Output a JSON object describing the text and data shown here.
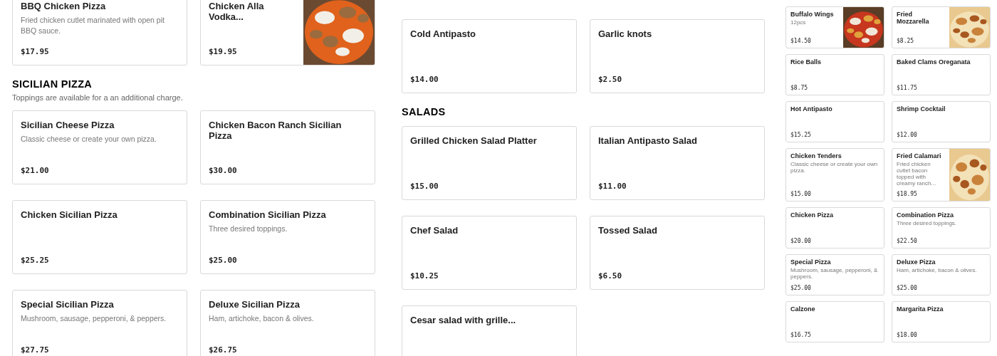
{
  "panels": [
    {
      "sections": [
        {
          "items": [
            {
              "name": "BBQ Chicken Pizza",
              "description": "Fried chicken cutlet marinated with open pit BBQ sauce.",
              "price": "$17.95"
            },
            {
              "name": "Chicken Alla Vodka...",
              "price": "$19.95"
            }
          ]
        },
        {
          "title": "SICILIAN PIZZA",
          "subtitle": "Toppings are available for a an additional charge.",
          "items": [
            {
              "name": "Sicilian Cheese Pizza",
              "description": "Classic cheese or create your own pizza.",
              "price": "$21.00"
            },
            {
              "name": "Chicken Bacon Ranch Sicilian Pizza",
              "price": "$30.00"
            },
            {
              "name": "Chicken Sicilian Pizza",
              "price": "$25.25"
            },
            {
              "name": "Combination Sicilian Pizza",
              "description": "Three desired toppings.",
              "price": "$25.00"
            },
            {
              "name": "Special Sicilian Pizza",
              "description": "Mushroom, sausage, pepperoni, & peppers.",
              "price": "$27.75"
            },
            {
              "name": "Deluxe Sicilian Pizza",
              "description": "Ham, artichoke, bacon & olives.",
              "price": "$26.75"
            }
          ]
        }
      ]
    },
    {
      "sections": [
        {
          "items": [
            {
              "name": "Cold Antipasto",
              "price": "$14.00"
            },
            {
              "name": "Garlic knots",
              "price": "$2.50"
            }
          ]
        },
        {
          "title": "SALADS",
          "items": [
            {
              "name": "Grilled Chicken Salad Platter",
              "price": "$15.00"
            },
            {
              "name": "Italian Antipasto Salad",
              "price": "$11.00"
            },
            {
              "name": "Chef Salad",
              "price": "$10.25"
            },
            {
              "name": "Tossed Salad",
              "price": "$6.50"
            },
            {
              "name": "Cesar salad with grille..."
            }
          ]
        }
      ]
    },
    {
      "sections": [
        {
          "items": [
            {
              "name": "Buffalo Wings",
              "description": "12pcs",
              "price": "$14.50"
            },
            {
              "name": "Fried Mozzarella",
              "price": "$8.25"
            },
            {
              "name": "Rice Balls",
              "price": "$8.75"
            },
            {
              "name": "Baked Clams Oreganata",
              "price": "$11.75"
            },
            {
              "name": "Hot Antipasto",
              "price": "$15.25"
            },
            {
              "name": "Shrimp Cocktail",
              "price": "$12.00"
            },
            {
              "name": "Chicken Tenders",
              "description": "Classic cheese or create your own pizza.",
              "price": "$15.00"
            },
            {
              "name": "Fried Calamari",
              "description": "Fried chicken cutlet bacon topped with creamy ranch...",
              "price": "$18.95"
            },
            {
              "name": "Chicken Pizza",
              "price": "$20.00"
            },
            {
              "name": "Combination Pizza",
              "description": "Three desired toppings.",
              "price": "$22.50"
            },
            {
              "name": "Special Pizza",
              "description": "Mushroom, sausage, pepperoni, & peppers.",
              "price": "$25.00"
            },
            {
              "name": "Deluxe Pizza",
              "description": "Ham, artichoke, bacon & olives.",
              "price": "$25.00"
            },
            {
              "name": "Calzone",
              "price": "$16.75"
            },
            {
              "name": "Margarita Pizza",
              "price": "$18.00"
            }
          ]
        }
      ]
    }
  ]
}
